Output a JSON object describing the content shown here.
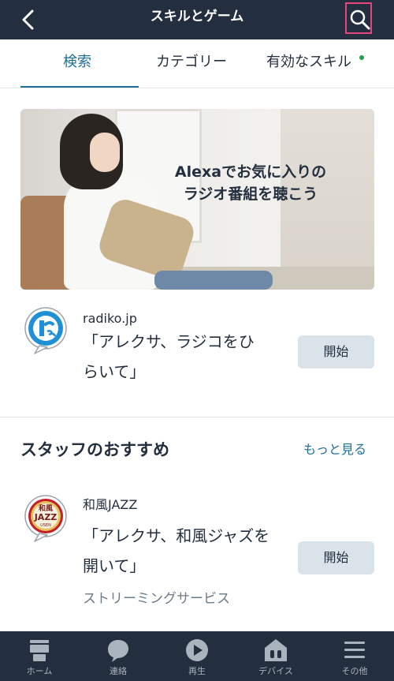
{
  "header": {
    "title": "スキルとゲーム",
    "back_icon": "chevron-left-icon",
    "search_icon": "search-icon"
  },
  "tabs": [
    {
      "label": "検索",
      "active": true
    },
    {
      "label": "カテゴリー",
      "active": false
    },
    {
      "label": "有効なスキル",
      "active": false,
      "has_badge": true
    }
  ],
  "banner": {
    "line1": "Alexaでお気に入りの",
    "line2": "ラジオ番組を聴こう"
  },
  "featured_skill": {
    "name": "radiko.jp",
    "phrase_line1": "「アレクサ、ラジコをひ",
    "phrase_line2": "らいて」",
    "button_label": "開始"
  },
  "staff_picks": {
    "title": "スタッフのおすすめ",
    "see_more": "もっと見る",
    "skill": {
      "name": "和風JAZZ",
      "phrase_line1": "「アレクサ、和風ジャズを",
      "phrase_line2": "開いて」",
      "button_label": "開始",
      "category": "ストリーミングサービス",
      "icon_text_top": "和風",
      "icon_text_main": "JAZZ",
      "icon_text_small": "USEN"
    }
  },
  "bottom_nav": [
    {
      "label": "ホーム",
      "icon": "home-icon"
    },
    {
      "label": "連絡",
      "icon": "chat-bubble-icon"
    },
    {
      "label": "再生",
      "icon": "play-icon"
    },
    {
      "label": "デバイス",
      "icon": "devices-icon"
    },
    {
      "label": "その他",
      "icon": "menu-icon"
    }
  ],
  "colors": {
    "header_bg": "#232f3e",
    "accent": "#1f6f98",
    "button_bg": "#dbe3ea",
    "badge": "#24a148"
  }
}
